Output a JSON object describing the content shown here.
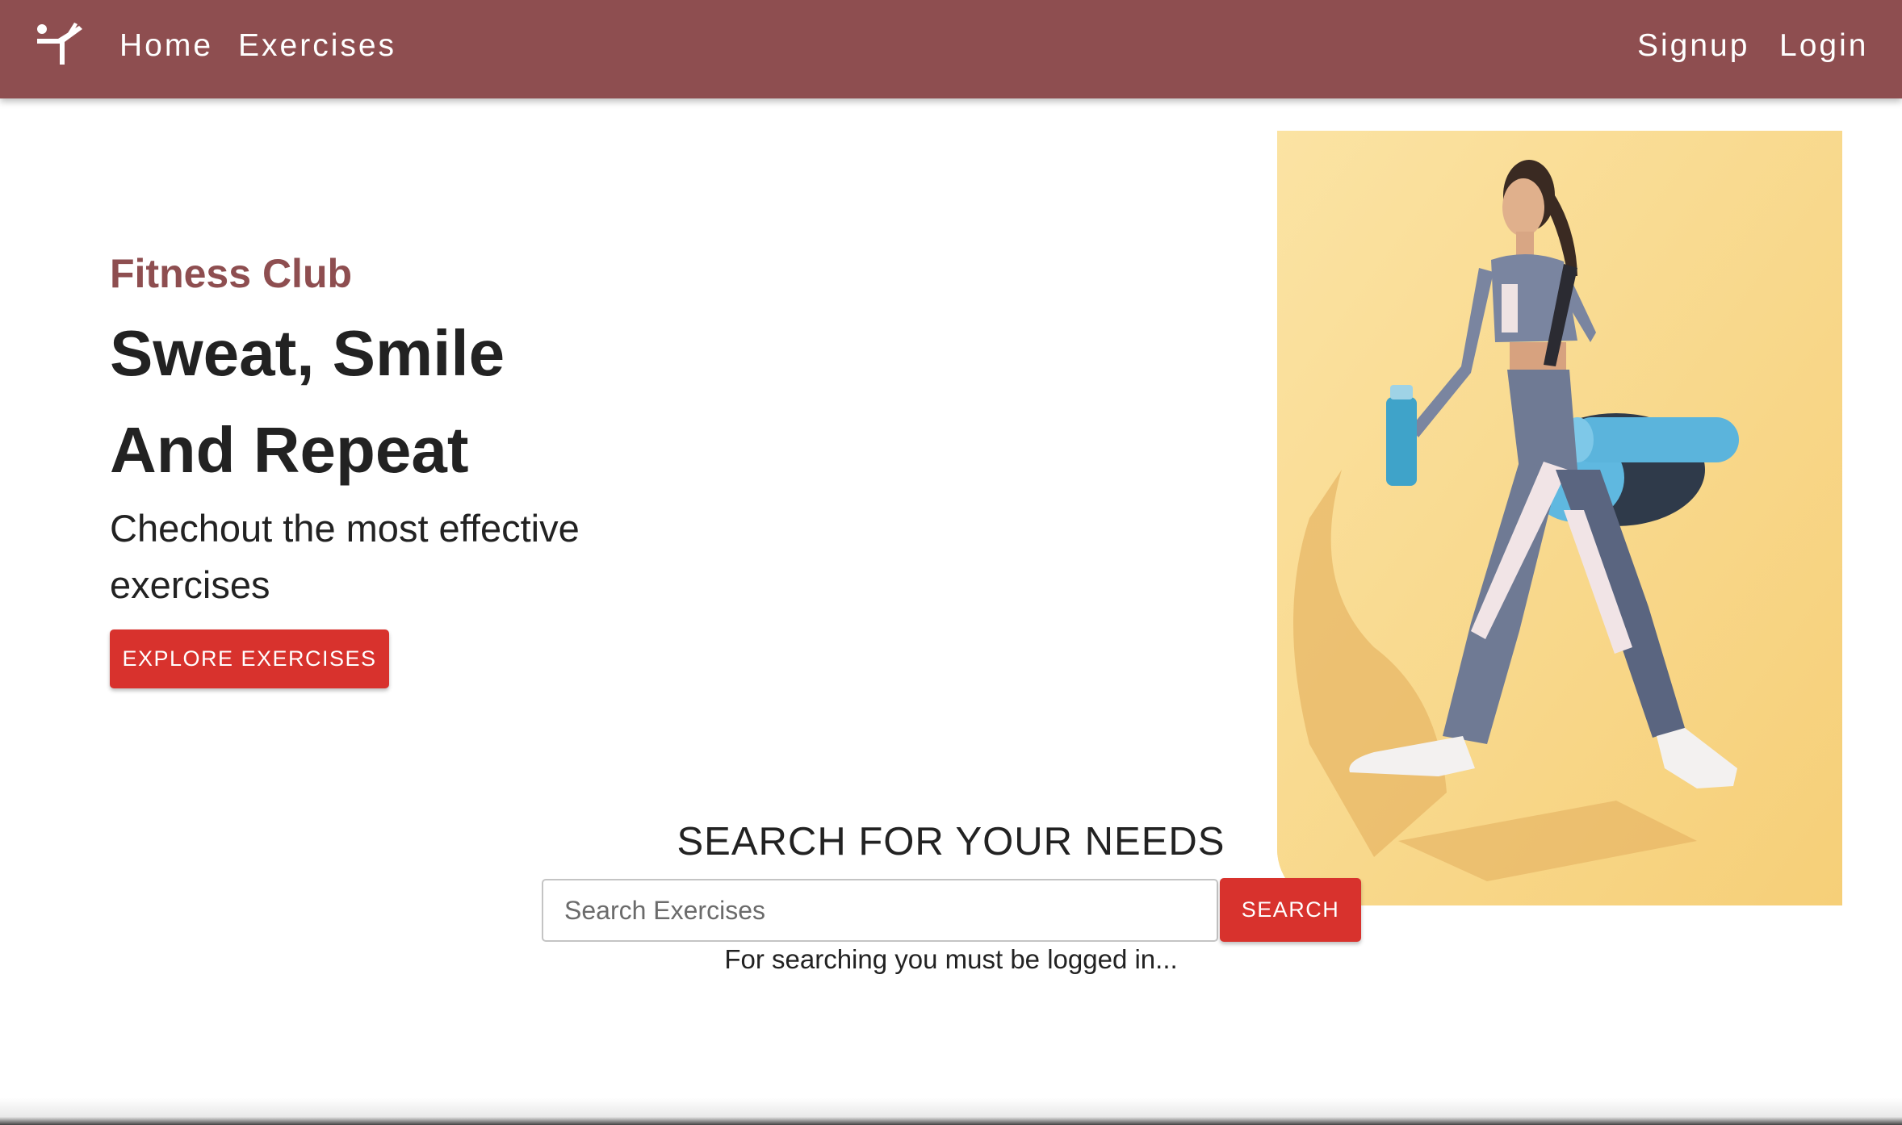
{
  "nav": {
    "logo_icon": "gymnast-logo-icon",
    "links": [
      "Home",
      "Exercises"
    ],
    "signup": "Signup",
    "login": "Login",
    "bar_color": "#8e4e50"
  },
  "hero": {
    "subtitle": "Fitness Club",
    "title_line1": "Sweat, Smile",
    "title_line2": "And Repeat",
    "description": "Chechout the most effective exercises",
    "cta_label": "EXPLORE EXERCISES",
    "image_icon": "fitness-woman-photo"
  },
  "search": {
    "heading": "SEARCH FOR YOUR NEEDS",
    "placeholder": "Search Exercises",
    "value": "",
    "button_label": "SEARCH",
    "note": "For searching you must be logged in..."
  },
  "colors": {
    "accent": "#d8322d",
    "brand": "#8e4e50",
    "image_bg": "#f8d68a"
  }
}
